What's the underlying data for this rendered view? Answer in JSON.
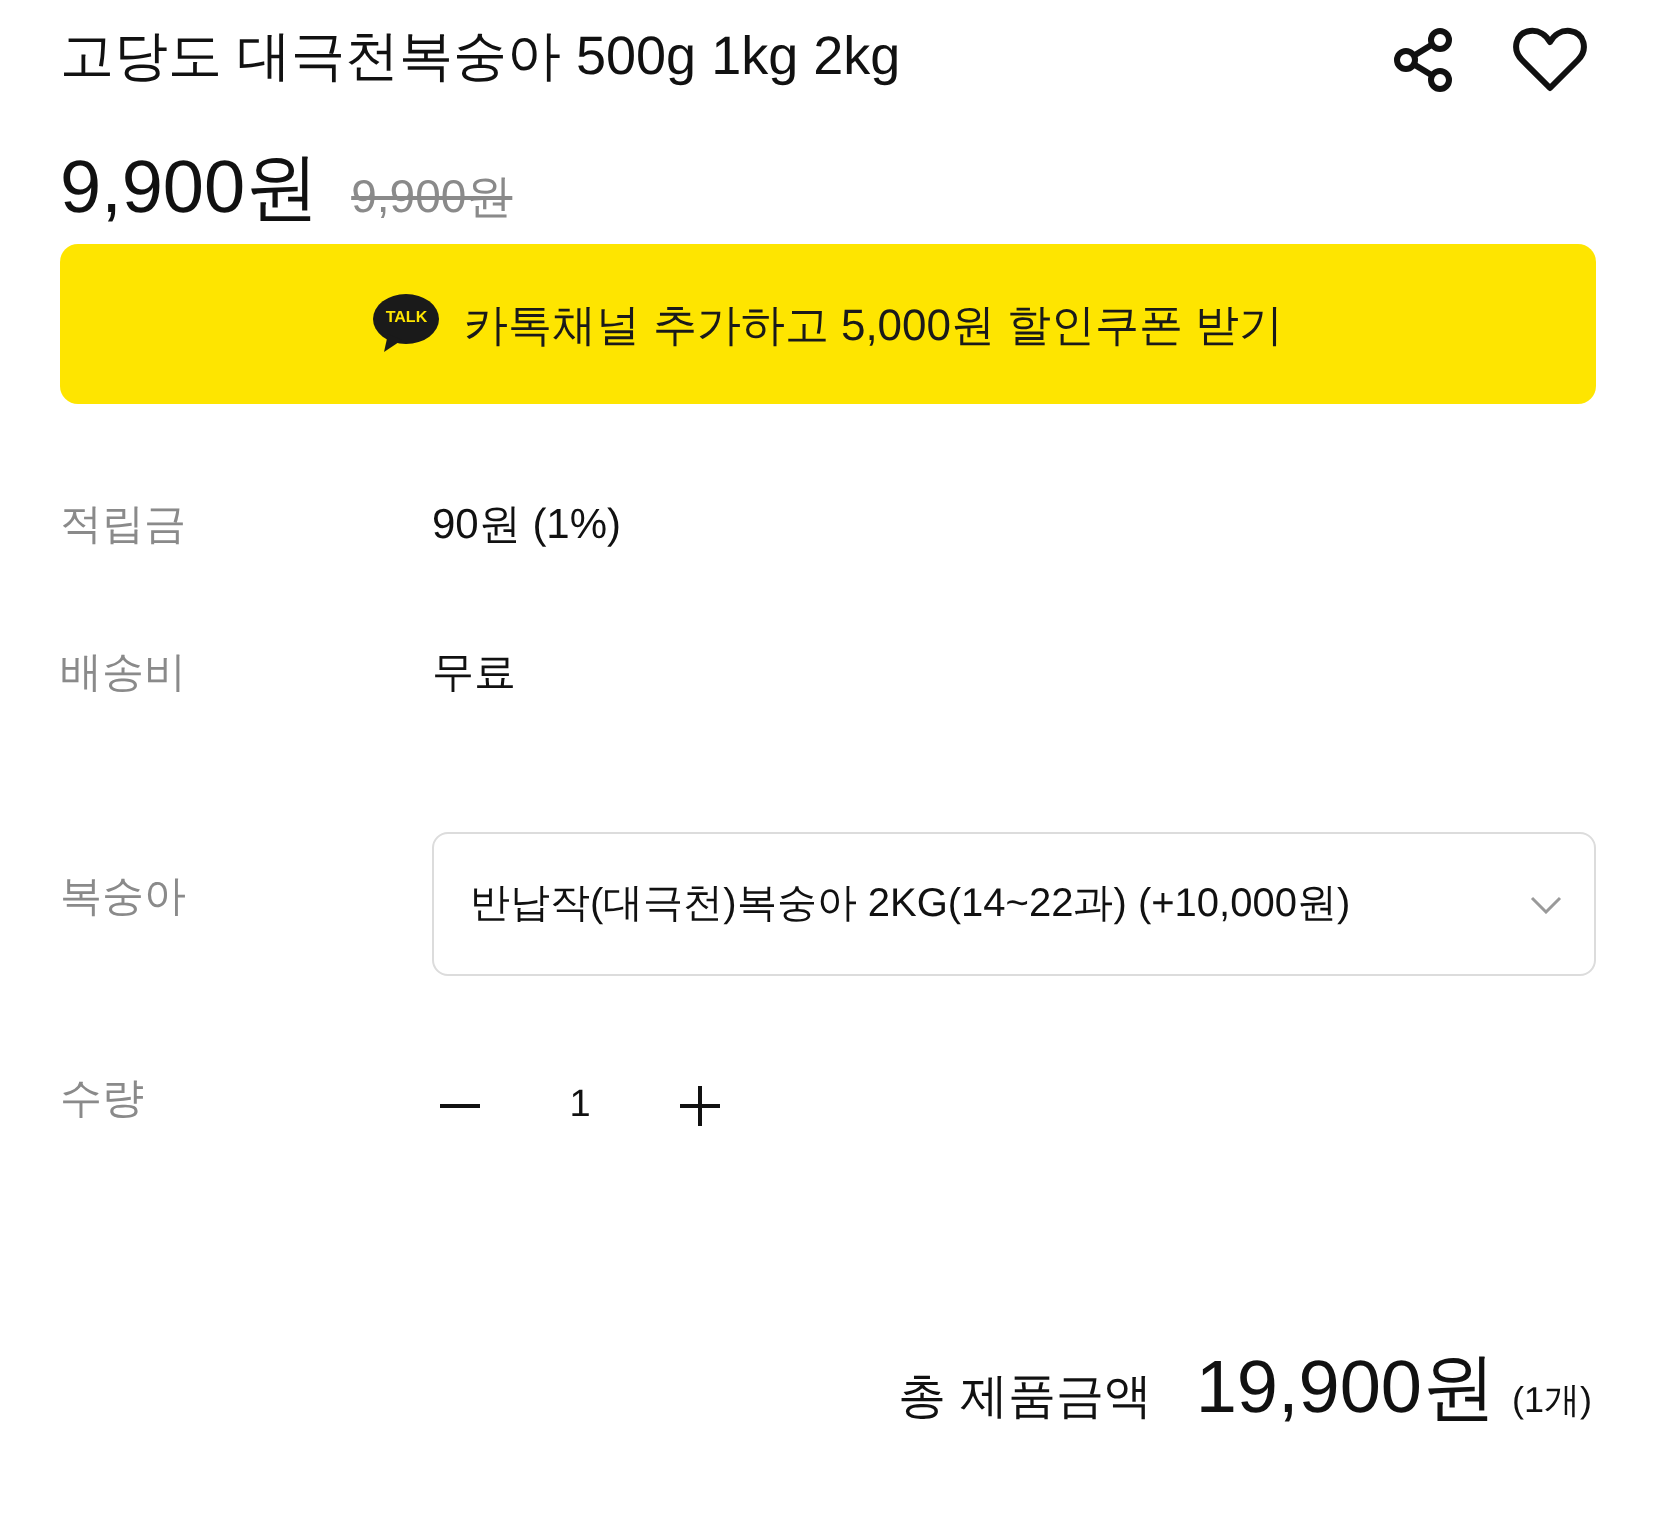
{
  "title": "고당도 대극천복숭아 500g 1kg 2kg",
  "price": {
    "sale": "9,900원",
    "original": "9,900원"
  },
  "coupon_banner": {
    "badge": "TALK",
    "text": "카톡채널 추가하고 5,000원 할인쿠폰 받기"
  },
  "info_rows": [
    {
      "label": "적립금",
      "value": "90원 (1%)"
    },
    {
      "label": "배송비",
      "value": "무료"
    }
  ],
  "option": {
    "label": "복숭아",
    "value": "반납작(대극천)복숭아 2KG(14~22과) (+10,000원)"
  },
  "quantity": {
    "label": "수량",
    "value": "1"
  },
  "total": {
    "label": "총 제품금액",
    "amount": "19,900원",
    "count": "(1개)"
  }
}
